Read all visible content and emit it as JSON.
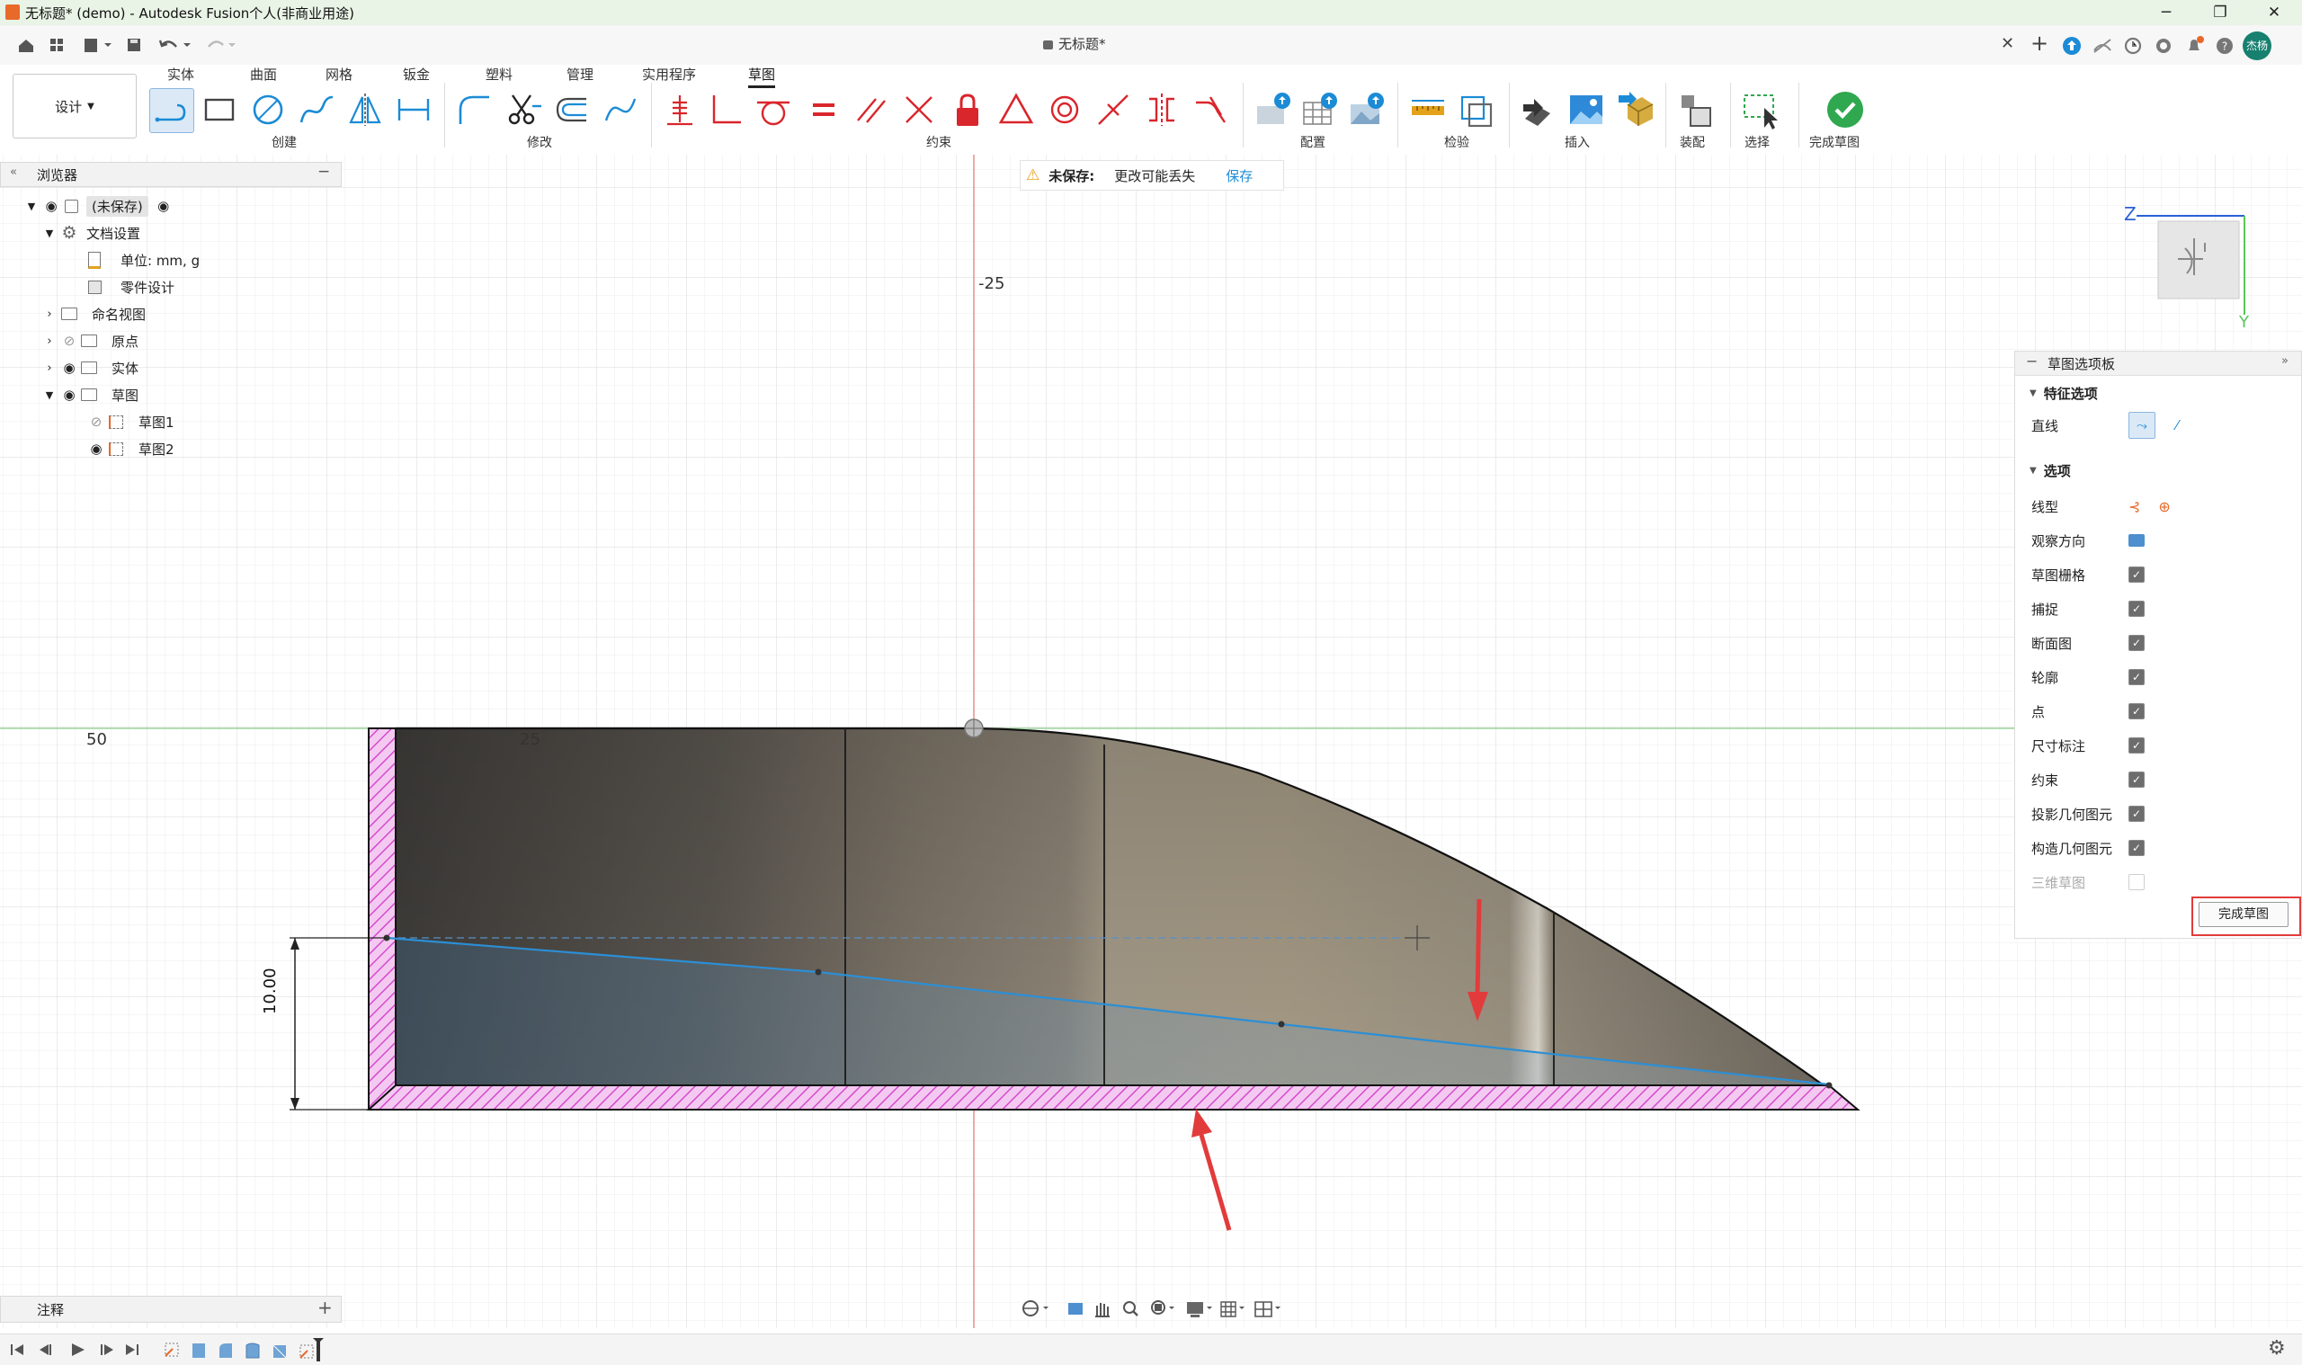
{
  "window": {
    "title": "无标题* (demo) - Autodesk Fusion个人(非商业用途)",
    "controls": [
      "─",
      "❐",
      "✕"
    ]
  },
  "tabbar": {
    "document_tab": "无标题*",
    "close": "✕",
    "add": "+"
  },
  "ribbon": {
    "workspace": "设计",
    "tabs": [
      "实体",
      "曲面",
      "网格",
      "钣金",
      "塑料",
      "管理",
      "实用程序",
      "草图"
    ],
    "active_tab": "草图",
    "groups": {
      "create": "创建",
      "modify": "修改",
      "constraints": "约束",
      "configure": "配置",
      "inspect": "检验",
      "insert": "插入",
      "assemble": "装配",
      "select": "选择",
      "finish": "完成草图"
    }
  },
  "browser": {
    "title": "浏览器",
    "items": [
      {
        "label": "(未保存)"
      },
      {
        "label": "文档设置"
      },
      {
        "label": "单位: mm, g"
      },
      {
        "label": "零件设计"
      },
      {
        "label": "命名视图"
      },
      {
        "label": "原点"
      },
      {
        "label": "实体"
      },
      {
        "label": "草图"
      },
      {
        "label": "草图1"
      },
      {
        "label": "草图2"
      }
    ]
  },
  "warning": {
    "label": "未保存:",
    "message": "更改可能丢失",
    "save": "保存"
  },
  "canvas": {
    "ruler_labels": [
      "-25",
      "50",
      "25"
    ],
    "dimension": "10.00"
  },
  "viewcube": {
    "axis_z": "Z",
    "axis_y": "Y"
  },
  "palette": {
    "title": "草图选项板",
    "section_feature": "特征选项",
    "line_label": "直线",
    "section_options": "选项",
    "options": [
      {
        "label": "线型",
        "kind": "icons"
      },
      {
        "label": "观察方向",
        "kind": "icon"
      },
      {
        "label": "草图栅格",
        "checked": true
      },
      {
        "label": "捕捉",
        "checked": true
      },
      {
        "label": "断面图",
        "checked": true
      },
      {
        "label": "轮廓",
        "checked": true
      },
      {
        "label": "点",
        "checked": true
      },
      {
        "label": "尺寸标注",
        "checked": true
      },
      {
        "label": "约束",
        "checked": true
      },
      {
        "label": "投影几何图元",
        "checked": true
      },
      {
        "label": "构造几何图元",
        "checked": true
      },
      {
        "label": "三维草图",
        "checked": false,
        "disabled": true
      }
    ],
    "finish_button": "完成草图"
  },
  "notes": {
    "title": "注释",
    "add": "+"
  },
  "avatar_initials": "杰杨",
  "colors": {
    "accent_blue": "#1b8bd6",
    "finish_green": "#2fa84f",
    "constraint_red": "#d9262c",
    "highlight_red": "#e23b3b",
    "sketch_blue": "#2b8fd6",
    "hatch_pink": "#e05ad8"
  }
}
